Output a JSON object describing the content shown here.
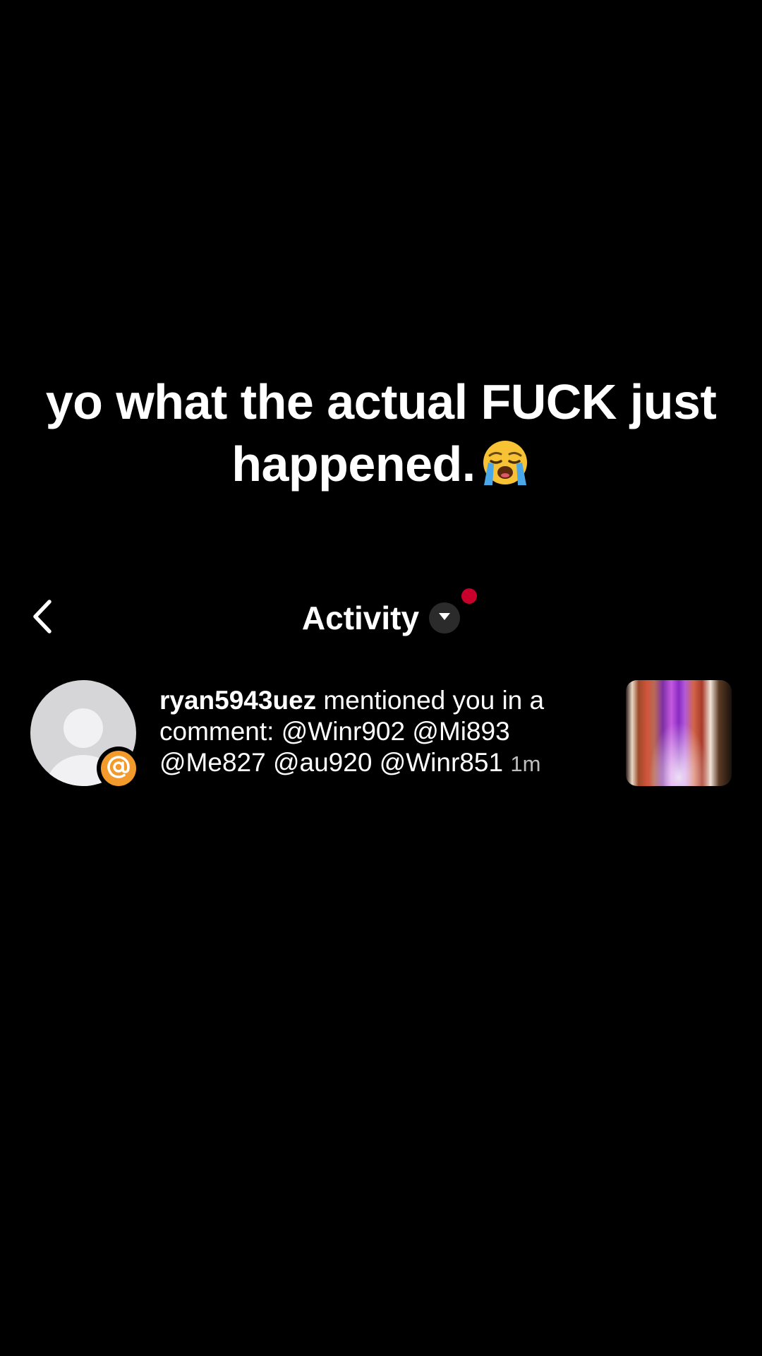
{
  "caption": {
    "text": "yo what the actual FUCK just happened.",
    "emoji": "😭"
  },
  "header": {
    "title": "Activity",
    "back_icon": "chevron-left-icon",
    "dropdown_icon": "caret-down-icon",
    "notification_dot_color": "#c8002c"
  },
  "notification": {
    "username": "ryan5943uez",
    "message": " mentioned you in a comment: @Winr902 @Mi893 @Me827 @au920 @Winr851",
    "time": "1m",
    "badge_icon": "at-sign-icon",
    "badge_color": "#f39a2c"
  }
}
